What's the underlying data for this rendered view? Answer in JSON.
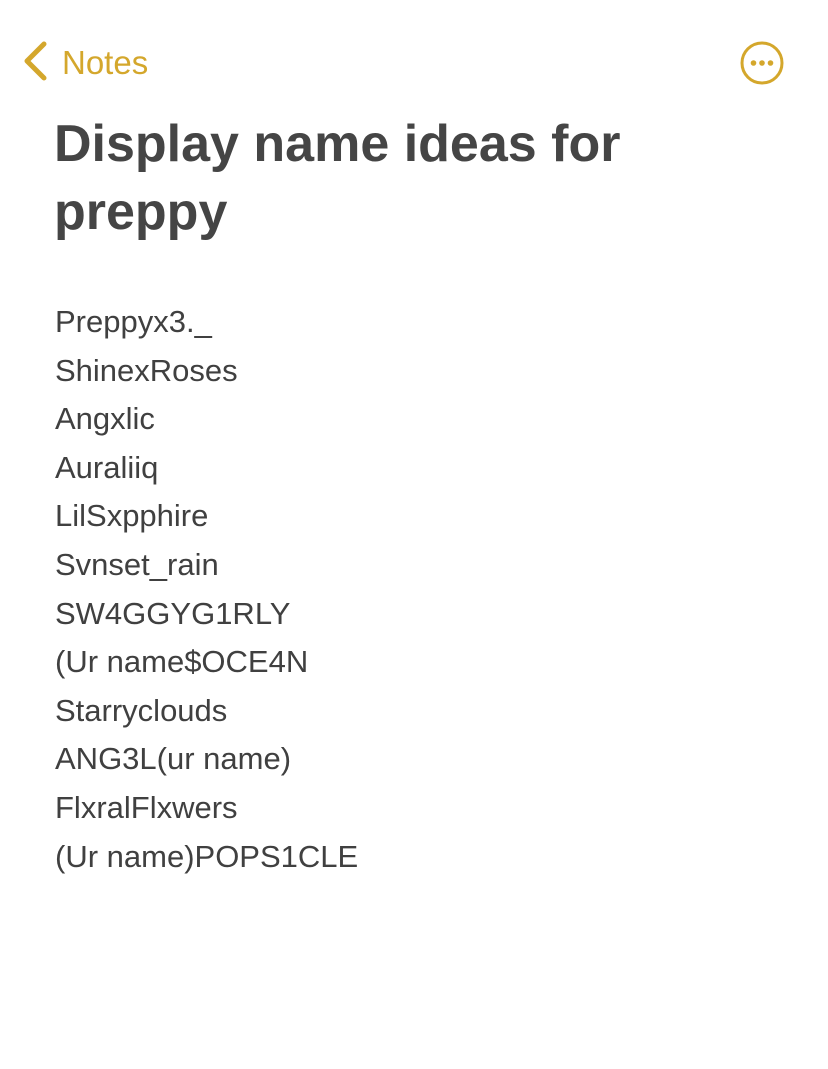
{
  "nav": {
    "back_label": "Notes",
    "back_icon": "chevron-left-icon",
    "more_icon": "ellipsis-circle-icon",
    "accent_color": "#d4a72c"
  },
  "note": {
    "title": "Display name ideas for preppy",
    "lines": [
      "Preppyx3._",
      "ShinexRoses",
      "Angxlic",
      "Auraliiq",
      "LilSxpphire",
      "Svnset_rain",
      "SW4GGYG1RLY",
      "(Ur name$OCE4N",
      "Starryclouds",
      "ANG3L(ur name)",
      "FlxralFlxwers",
      "(Ur name)POPS1CLE"
    ]
  }
}
